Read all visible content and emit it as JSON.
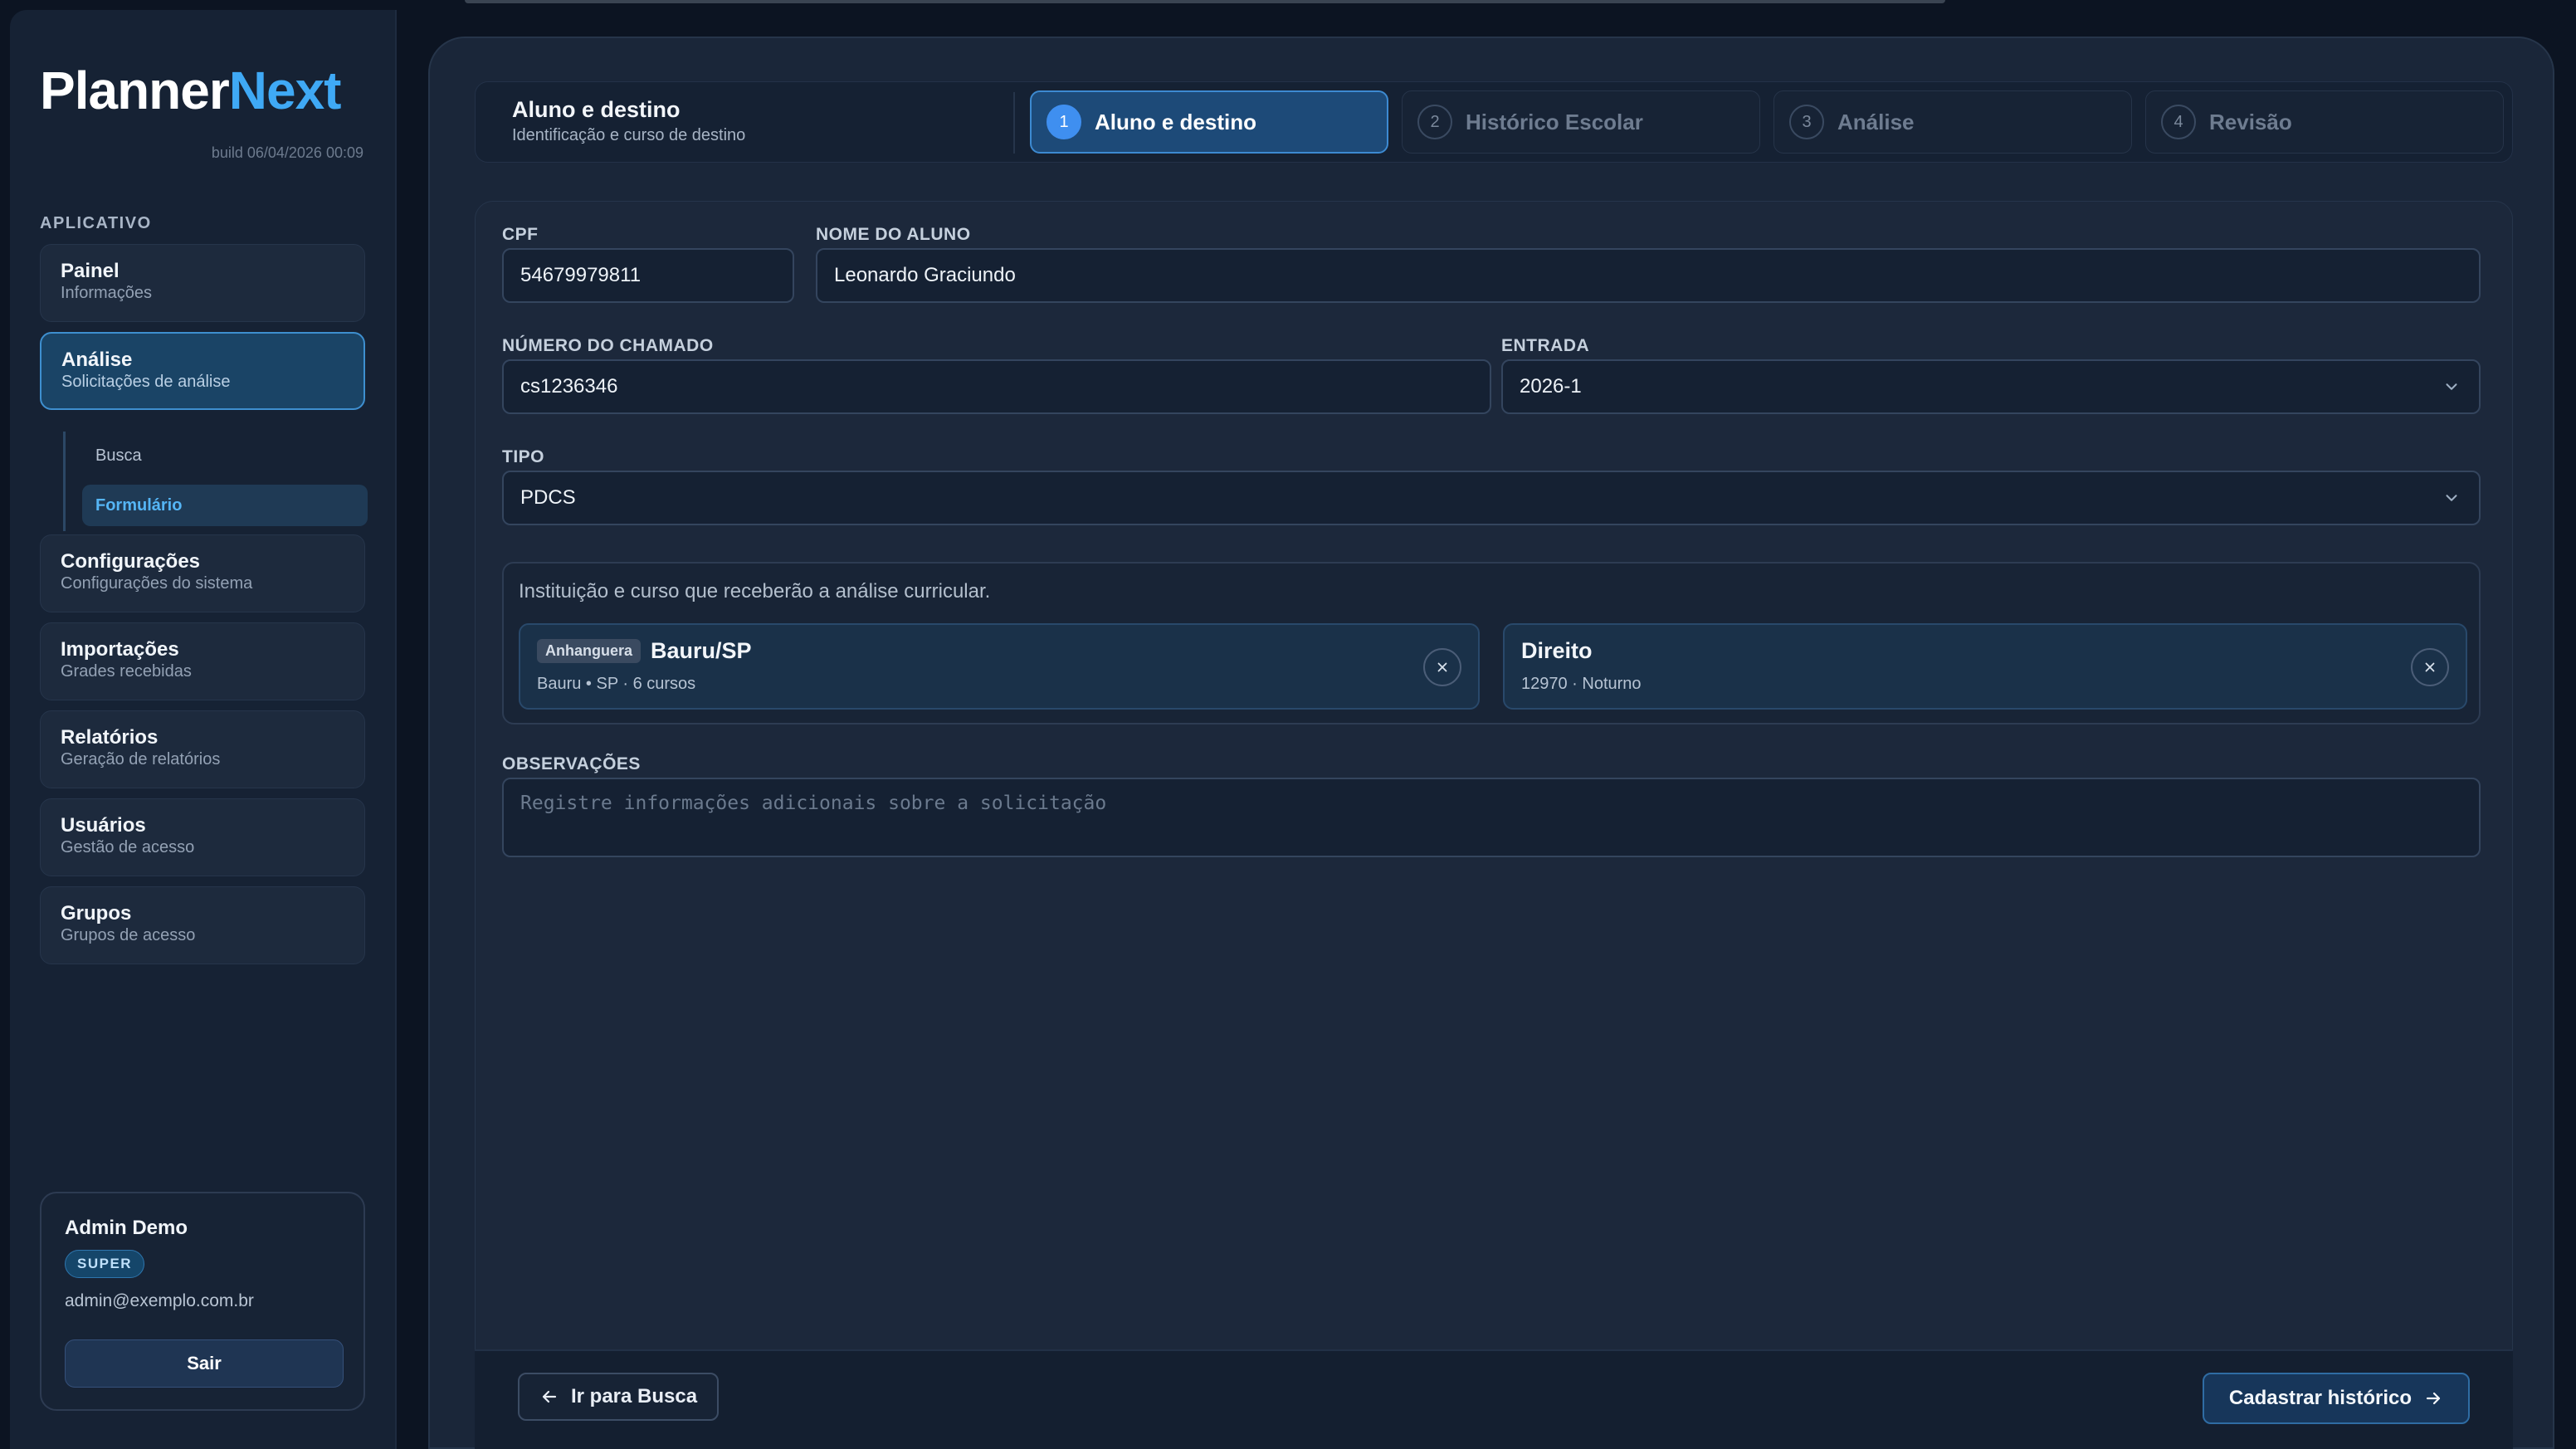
{
  "app": {
    "brand_part1": "Planner",
    "brand_part2": "Next",
    "build": "build 06/04/2026 00:09"
  },
  "sidebar": {
    "section_label": "APLICATIVO",
    "items": [
      {
        "title": "Painel",
        "subtitle": "Informações"
      },
      {
        "title": "Análise",
        "subtitle": "Solicitações de análise"
      },
      {
        "title": "Configurações",
        "subtitle": "Configurações do sistema"
      },
      {
        "title": "Importações",
        "subtitle": "Grades recebidas"
      },
      {
        "title": "Relatórios",
        "subtitle": "Geração de relatórios"
      },
      {
        "title": "Usuários",
        "subtitle": "Gestão de acesso"
      },
      {
        "title": "Grupos",
        "subtitle": "Grupos de acesso"
      }
    ],
    "subitems": [
      {
        "label": "Busca"
      },
      {
        "label": "Formulário"
      }
    ]
  },
  "user": {
    "name": "Admin Demo",
    "role": "SUPER",
    "email": "admin@exemplo.com.br",
    "logout_label": "Sair"
  },
  "stepper": {
    "title": "Aluno e destino",
    "subtitle": "Identificação e curso de destino",
    "steps": [
      {
        "num": "1",
        "label": "Aluno e destino"
      },
      {
        "num": "2",
        "label": "Histórico Escolar"
      },
      {
        "num": "3",
        "label": "Análise"
      },
      {
        "num": "4",
        "label": "Revisão"
      }
    ]
  },
  "form": {
    "cpf_label": "CPF",
    "cpf_value": "54679979811",
    "nome_label": "NOME DO ALUNO",
    "nome_value": "Leonardo Graciundo",
    "chamado_label": "NÚMERO DO CHAMADO",
    "chamado_value": "cs1236346",
    "entrada_label": "ENTRADA",
    "entrada_value": "2026-1",
    "tipo_label": "TIPO",
    "tipo_value": "PDCS",
    "dest_hint": "Instituição e curso que receberão a análise curricular.",
    "institution": {
      "tag": "Anhanguera",
      "name": "Bauru/SP",
      "detail": "Bauru • SP · 6 cursos"
    },
    "course": {
      "name": "Direito",
      "detail": "12970 · Noturno"
    },
    "obs_label": "OBSERVAÇÕES",
    "obs_placeholder": "Registre informações adicionais sobre a solicitação"
  },
  "footer": {
    "back_label": "Ir para Busca",
    "next_label": "Cadastrar histórico"
  }
}
